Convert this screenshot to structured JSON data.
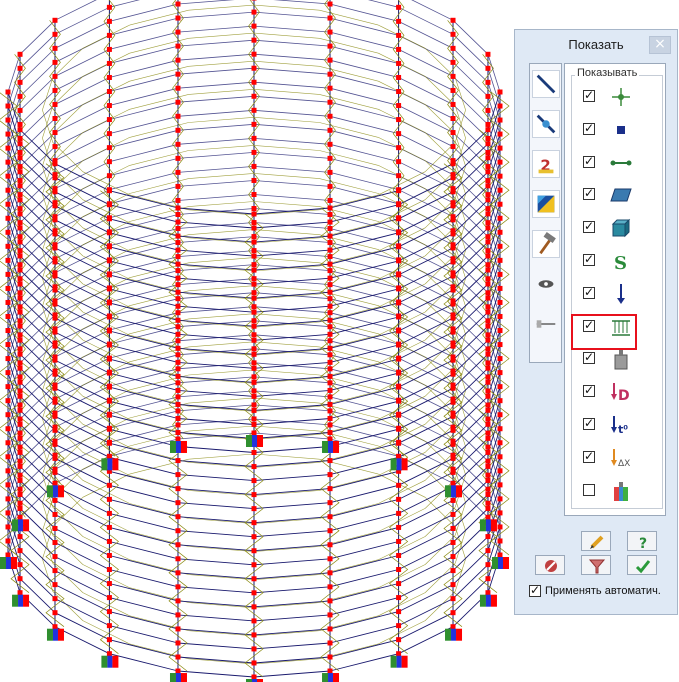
{
  "panel": {
    "title": "Показать",
    "close_label": "×",
    "group_label": "Показывать",
    "auto_apply_label": "Применять автоматич.",
    "auto_apply_checked": true
  },
  "toolbar": {
    "tools": [
      {
        "icon": "line-element-icon",
        "selected": true
      },
      {
        "icon": "node-element-icon",
        "selected": true
      },
      {
        "icon": "numbering-icon",
        "selected": true
      },
      {
        "icon": "color-scale-icon",
        "selected": true
      },
      {
        "icon": "hammer-icon",
        "selected": true
      },
      {
        "icon": "eye-icon",
        "selected": false
      },
      {
        "icon": "pin-icon",
        "selected": false
      }
    ]
  },
  "display_options": [
    {
      "icon": "node-icon",
      "checked": true,
      "highlighted": false
    },
    {
      "icon": "square-point-icon",
      "checked": true,
      "highlighted": false
    },
    {
      "icon": "bar-element-icon",
      "checked": true,
      "highlighted": false
    },
    {
      "icon": "plate-element-icon",
      "checked": true,
      "highlighted": false
    },
    {
      "icon": "solid-element-icon",
      "checked": true,
      "highlighted": false
    },
    {
      "icon": "section-s-icon",
      "checked": true,
      "highlighted": false,
      "glyph": "S"
    },
    {
      "icon": "point-load-arrow-icon",
      "checked": true,
      "highlighted": false
    },
    {
      "icon": "distributed-load-icon",
      "checked": true,
      "highlighted": true
    },
    {
      "icon": "weight-icon",
      "checked": true,
      "highlighted": false
    },
    {
      "icon": "displacement-load-icon",
      "checked": true,
      "highlighted": false,
      "glyph": "D"
    },
    {
      "icon": "temperature-load-icon",
      "checked": true,
      "highlighted": false,
      "glyph": "t⁰"
    },
    {
      "icon": "delta-x-load-icon",
      "checked": true,
      "highlighted": false,
      "glyph": "ΔX"
    },
    {
      "icon": "colored-weight-icon",
      "checked": false,
      "highlighted": false
    }
  ],
  "bottom_buttons": [
    {
      "icon": "pencil-icon"
    },
    {
      "icon": "help-icon",
      "glyph": "?"
    },
    {
      "icon": "eraser-icon"
    },
    {
      "icon": "filter-icon"
    },
    {
      "icon": "apply-check-icon",
      "glyph": "✓"
    }
  ],
  "colors": {
    "frame_line": "#1a1a6e",
    "truss_line": "#8a8a10",
    "node_marker": "#ff0000",
    "support_blue": "#2233dd",
    "support_green": "#2f8f2f",
    "highlight_box": "#e8101c"
  }
}
